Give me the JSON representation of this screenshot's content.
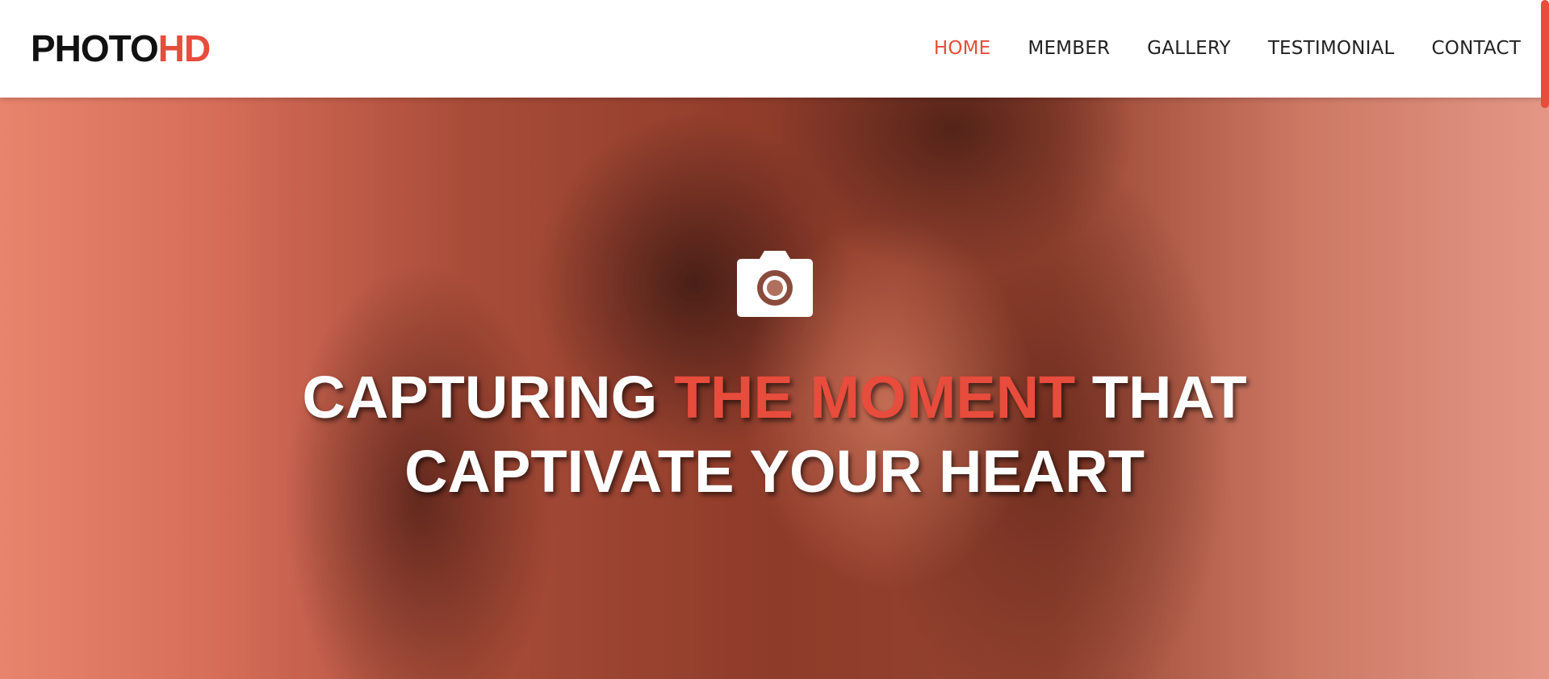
{
  "brand": {
    "part1": "PHOTO",
    "part2": "HD"
  },
  "nav": {
    "items": [
      {
        "label": "HOME",
        "active": true
      },
      {
        "label": "MEMBER",
        "active": false
      },
      {
        "label": "GALLERY",
        "active": false
      },
      {
        "label": "TESTIMONIAL",
        "active": false
      },
      {
        "label": "CONTACT",
        "active": false
      }
    ]
  },
  "hero": {
    "icon": "camera-icon",
    "headline": {
      "line1_a": "CAPTURING ",
      "line1_highlight": "THE MOMENT",
      "line1_b": " THAT",
      "line2": "CAPTIVATE YOUR HEART"
    }
  },
  "colors": {
    "accent": "#e74c3c",
    "text_dark": "#111111",
    "nav_text": "#222222",
    "headline": "#ffffff"
  }
}
